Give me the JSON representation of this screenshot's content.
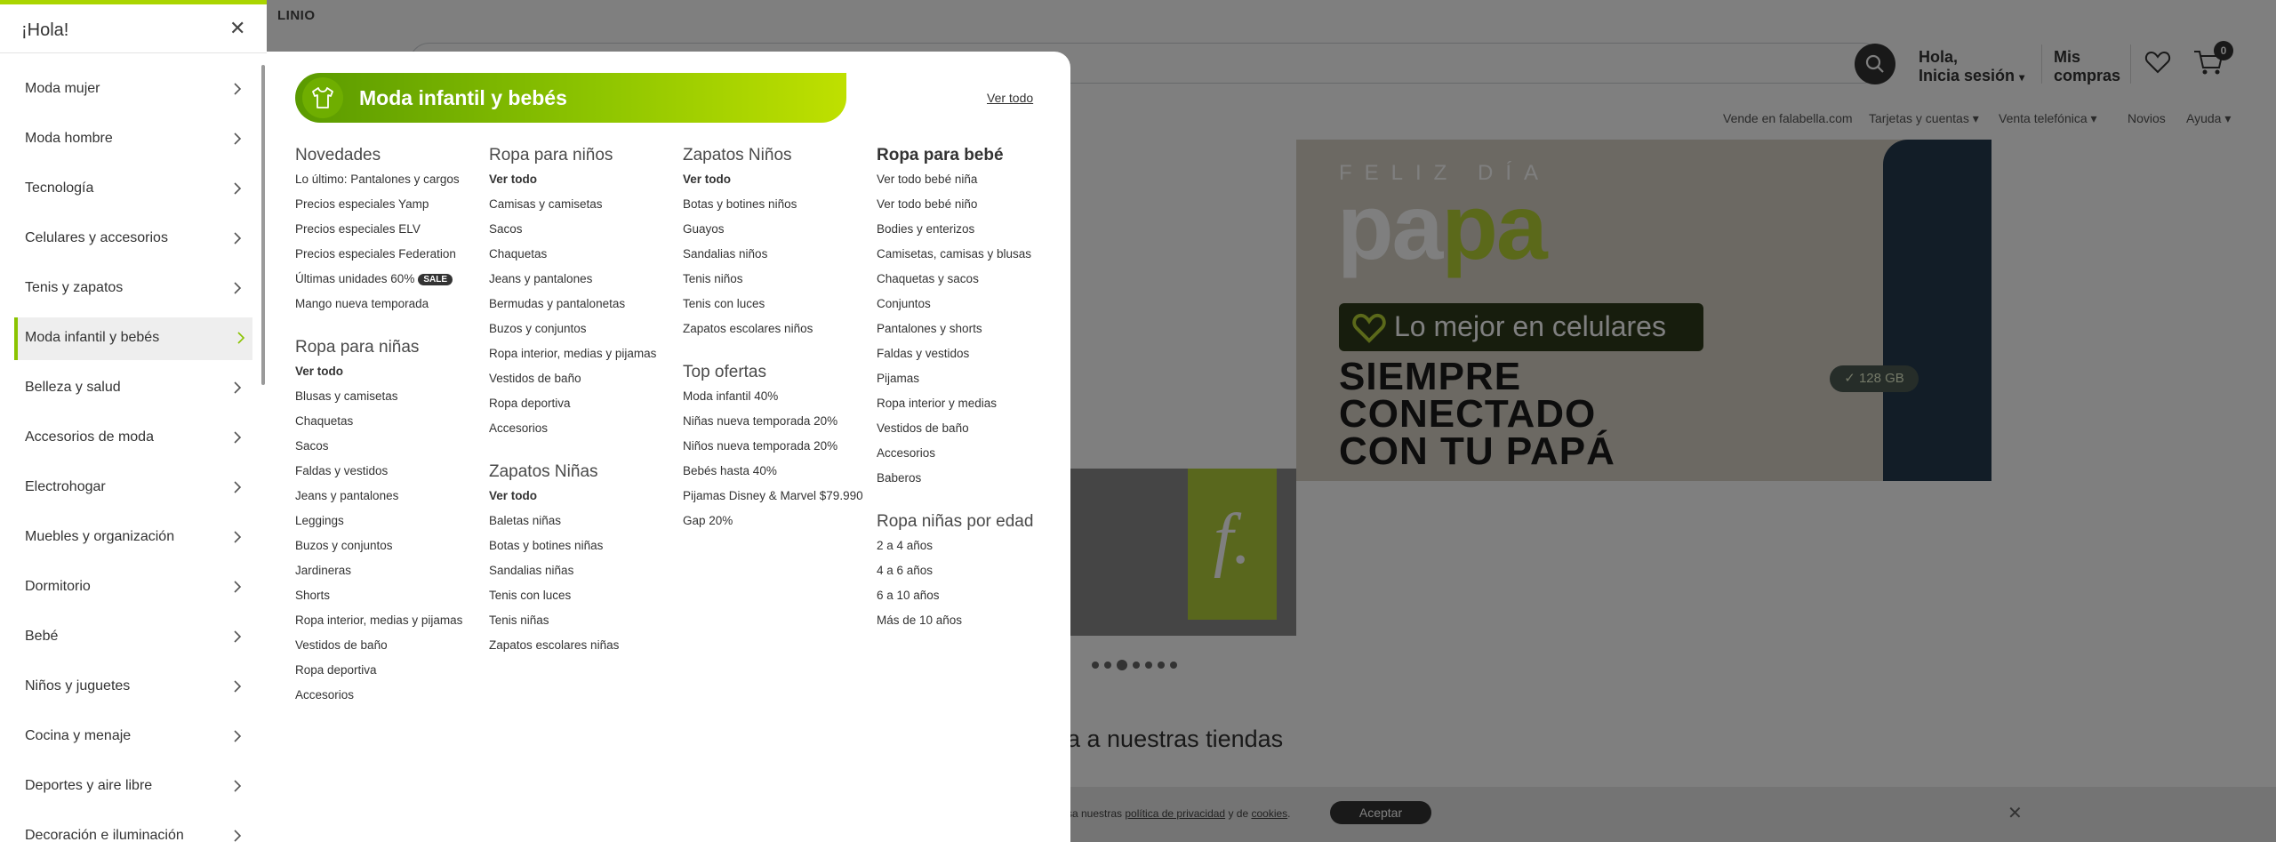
{
  "header": {
    "logo_text": "LINIO",
    "greeting_line1": "Hola,",
    "greeting_line2": "Inicia sesión",
    "mis_line1": "Mis",
    "mis_line2": "compras",
    "cart_count": "0"
  },
  "top_nav": [
    "Vende en falabella.com",
    "Tarjetas y cuentas",
    "Venta telefónica",
    "Novios",
    "Ayuda"
  ],
  "banner": {
    "feliz": "FELIZ DÍA",
    "papa_1": "pa",
    "papa_2": "pa",
    "pill": "Lo mejor en celulares",
    "line1": "SIEMPRE",
    "line2": "CONECTADO",
    "line3": "CON TU PAPÁ",
    "gb": "128 GB",
    "f_logo": "f."
  },
  "tiendas": "a a nuestras tiendas",
  "cookie": {
    "prefix": "sa nuestras ",
    "link1": "política de privacidad",
    "mid": " y de ",
    "link2": "cookies",
    "accept": "Aceptar"
  },
  "sidebar": {
    "title": "¡Hola!",
    "items": [
      {
        "label": "Moda mujer"
      },
      {
        "label": "Moda hombre"
      },
      {
        "label": "Tecnología"
      },
      {
        "label": "Celulares y accesorios"
      },
      {
        "label": "Tenis y zapatos"
      },
      {
        "label": "Moda infantil y bebés"
      },
      {
        "label": "Belleza y salud"
      },
      {
        "label": "Accesorios de moda"
      },
      {
        "label": "Electrohogar"
      },
      {
        "label": "Muebles y organización"
      },
      {
        "label": "Dormitorio"
      },
      {
        "label": "Bebé"
      },
      {
        "label": "Niños y juguetes"
      },
      {
        "label": "Cocina y menaje"
      },
      {
        "label": "Deportes y aire libre"
      },
      {
        "label": "Decoración e iluminación"
      }
    ],
    "active_index": 5
  },
  "mega": {
    "category_title": "Moda infantil y bebés",
    "ver_todo": "Ver todo",
    "columns": [
      [
        {
          "title": "Novedades",
          "links": [
            "Lo último: Pantalones y cargos",
            "Precios especiales Yamp",
            "Precios especiales ELV",
            "Precios especiales Federation",
            "Últimas unidades 60%",
            "Mango nueva temporada"
          ]
        },
        {
          "title": "Ropa para niñas",
          "links": [
            "Ver todo",
            "Blusas y camisetas",
            "Chaquetas",
            "Sacos",
            "Faldas y vestidos",
            "Jeans y pantalones",
            "Leggings",
            "Buzos y conjuntos",
            "Jardineras",
            "Shorts",
            "Ropa interior, medias y pijamas",
            "Vestidos de baño",
            "Ropa deportiva",
            "Accesorios"
          ]
        }
      ],
      [
        {
          "title": "Ropa para niños",
          "links": [
            "Ver todo",
            "Camisas y camisetas",
            "Sacos",
            "Chaquetas",
            "Jeans y pantalones",
            "Bermudas y pantalonetas",
            "Buzos y conjuntos",
            "Ropa interior, medias y pijamas",
            "Vestidos de baño",
            "Ropa deportiva",
            "Accesorios"
          ]
        },
        {
          "title": "Zapatos Niñas",
          "links": [
            "Ver todo",
            "Baletas niñas",
            "Botas y botines niñas",
            "Sandalias niñas",
            "Tenis con luces",
            "Tenis niñas",
            "Zapatos escolares niñas"
          ]
        }
      ],
      [
        {
          "title": "Zapatos Niños",
          "links": [
            "Ver todo",
            "Botas y botines niños",
            "Guayos",
            "Sandalias niños",
            "Tenis niños",
            "Tenis con luces",
            "Zapatos escolares niños"
          ]
        },
        {
          "title": "Top ofertas",
          "links": [
            "Moda infantil 40%",
            "Niñas nueva temporada 20%",
            "Niños nueva temporada 20%",
            "Bebés hasta 40%",
            "Pijamas Disney & Marvel $79.990",
            "Gap 20%"
          ]
        }
      ],
      [
        {
          "title": "Ropa para bebé",
          "links": [
            "Ver todo bebé niña",
            "Ver todo bebé niño",
            "Bodies y enterizos",
            "Camisetas, camisas y blusas",
            "Chaquetas y sacos",
            "Conjuntos",
            "Pantalones y shorts",
            "Faldas y vestidos",
            "Pijamas",
            "Ropa interior y medias",
            "Vestidos de baño",
            "Accesorios",
            "Baberos"
          ]
        },
        {
          "title": "Ropa niñas por edad",
          "links": [
            "2 a 4 años",
            "4 a 6 años",
            "6 a 10 años",
            "Más de 10 años"
          ]
        }
      ]
    ],
    "sale_badge": "SALE",
    "sale_badge_link": "Últimas unidades 60%"
  },
  "colors": {
    "accent": "#8ac300",
    "dark": "#333333"
  }
}
